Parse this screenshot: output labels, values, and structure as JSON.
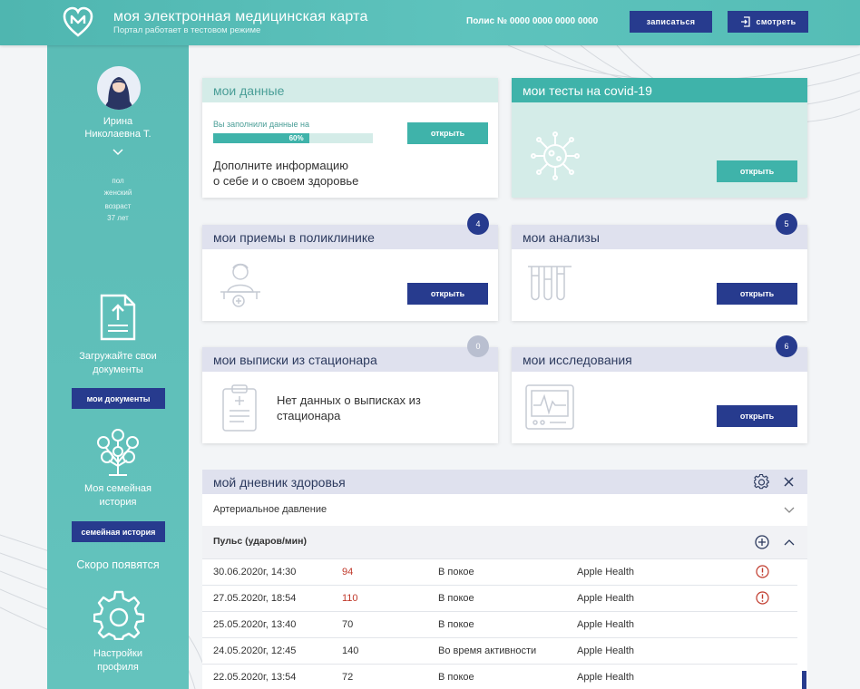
{
  "header": {
    "title": "моя электронная медицинская карта",
    "subtitle": "Портал работает в тестовом режиме",
    "polis": "Полис № 0000 0000 0000 0000",
    "signup_label": "записаться",
    "view_label": "смотреть"
  },
  "sidebar": {
    "user_name_line1": "Ирина",
    "user_name_line2": "Николаевна Т.",
    "gender_label": "пол",
    "gender_value": "женский",
    "age_label": "возраст",
    "age_value": "37 лет",
    "docs_text_line1": "Загружайте свои",
    "docs_text_line2": "документы",
    "docs_button": "мои документы",
    "family_text_line1": "Моя семейная",
    "family_text_line2": "история",
    "family_button": "семейная история",
    "coming_soon": "Скоро появятся",
    "settings_line1": "Настройки",
    "settings_line2": "профиля"
  },
  "cards": {
    "my_data": {
      "title": "мои данные",
      "progress_label": "Вы заполнили данные на",
      "progress_text": "60%",
      "progress_fraction": 0.6,
      "text_line1": "Дополните информацию",
      "text_line2": "о себе и о своем здоровье",
      "button": "открыть"
    },
    "covid": {
      "title": "мои тесты на covid-19",
      "button": "открыть"
    },
    "clinic": {
      "title": "мои приемы в поликлинике",
      "badge": "4",
      "button": "открыть"
    },
    "analyses": {
      "title": "мои анализы",
      "badge": "5",
      "button": "открыть"
    },
    "hospital": {
      "title": "мои выписки из стационара",
      "badge": "0",
      "text_line1": "Нет данных о выписках из",
      "text_line2": "стационара"
    },
    "research": {
      "title": "мои исследования",
      "badge": "6",
      "button": "открыть"
    }
  },
  "diary": {
    "title": "мой дневник здоровья",
    "section1": "Артериальное давление",
    "section2": "Пульс (ударов/мин)",
    "rows": [
      {
        "date": "30.06.2020г, 14:30",
        "value": "94",
        "state": "В покое",
        "source": "Apple Health",
        "alert": true
      },
      {
        "date": "27.05.2020г, 18:54",
        "value": "110",
        "state": "В покое",
        "source": "Apple Health",
        "alert": true
      },
      {
        "date": "25.05.2020г, 13:40",
        "value": "70",
        "state": "В покое",
        "source": "Apple Health",
        "alert": false
      },
      {
        "date": "24.05.2020г, 12:45",
        "value": "140",
        "state": "Во время активности",
        "source": "Apple Health",
        "alert": false
      },
      {
        "date": "22.05.2020г, 13:54",
        "value": "72",
        "state": "В покое",
        "source": "Apple Health",
        "alert": false
      }
    ]
  },
  "colors": {
    "teal": "#3fb3aa",
    "navy": "#273b8e",
    "alert_red": "#c0392b"
  }
}
